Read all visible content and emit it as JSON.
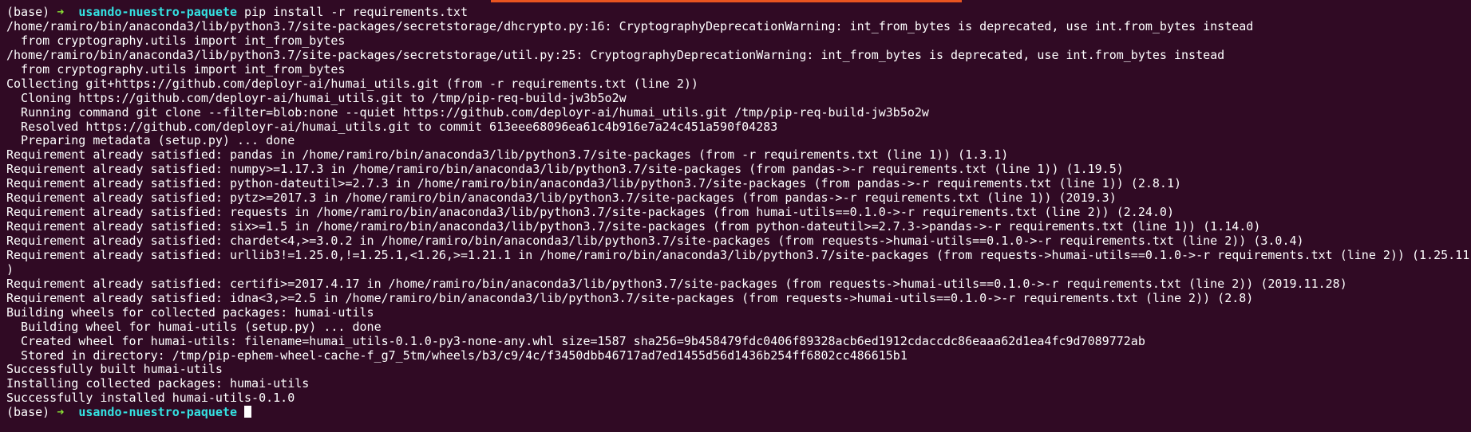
{
  "theme": {
    "background": "#300a24",
    "foreground": "#ffffff",
    "prompt_arrow_color": "#8ae234",
    "prompt_dir_color": "#34e2e2",
    "accent": "#e95420"
  },
  "prompt": {
    "env": "(base)",
    "arrow": "➜",
    "directory": "usando-nuestro-paquete",
    "command": "pip install -r requirements.txt"
  },
  "output_lines": [
    "/home/ramiro/bin/anaconda3/lib/python3.7/site-packages/secretstorage/dhcrypto.py:16: CryptographyDeprecationWarning: int_from_bytes is deprecated, use int.from_bytes instead",
    "  from cryptography.utils import int_from_bytes",
    "/home/ramiro/bin/anaconda3/lib/python3.7/site-packages/secretstorage/util.py:25: CryptographyDeprecationWarning: int_from_bytes is deprecated, use int.from_bytes instead",
    "  from cryptography.utils import int_from_bytes",
    "Collecting git+https://github.com/deployr-ai/humai_utils.git (from -r requirements.txt (line 2))",
    "  Cloning https://github.com/deployr-ai/humai_utils.git to /tmp/pip-req-build-jw3b5o2w",
    "  Running command git clone --filter=blob:none --quiet https://github.com/deployr-ai/humai_utils.git /tmp/pip-req-build-jw3b5o2w",
    "  Resolved https://github.com/deployr-ai/humai_utils.git to commit 613eee68096ea61c4b916e7a24c451a590f04283",
    "  Preparing metadata (setup.py) ... done",
    "Requirement already satisfied: pandas in /home/ramiro/bin/anaconda3/lib/python3.7/site-packages (from -r requirements.txt (line 1)) (1.3.1)",
    "Requirement already satisfied: numpy>=1.17.3 in /home/ramiro/bin/anaconda3/lib/python3.7/site-packages (from pandas->-r requirements.txt (line 1)) (1.19.5)",
    "Requirement already satisfied: python-dateutil>=2.7.3 in /home/ramiro/bin/anaconda3/lib/python3.7/site-packages (from pandas->-r requirements.txt (line 1)) (2.8.1)",
    "Requirement already satisfied: pytz>=2017.3 in /home/ramiro/bin/anaconda3/lib/python3.7/site-packages (from pandas->-r requirements.txt (line 1)) (2019.3)",
    "Requirement already satisfied: requests in /home/ramiro/bin/anaconda3/lib/python3.7/site-packages (from humai-utils==0.1.0->-r requirements.txt (line 2)) (2.24.0)",
    "Requirement already satisfied: six>=1.5 in /home/ramiro/bin/anaconda3/lib/python3.7/site-packages (from python-dateutil>=2.7.3->pandas->-r requirements.txt (line 1)) (1.14.0)",
    "Requirement already satisfied: chardet<4,>=3.0.2 in /home/ramiro/bin/anaconda3/lib/python3.7/site-packages (from requests->humai-utils==0.1.0->-r requirements.txt (line 2)) (3.0.4)",
    "Requirement already satisfied: urllib3!=1.25.0,!=1.25.1,<1.26,>=1.21.1 in /home/ramiro/bin/anaconda3/lib/python3.7/site-packages (from requests->humai-utils==0.1.0->-r requirements.txt (line 2)) (1.25.11",
    ")",
    "Requirement already satisfied: certifi>=2017.4.17 in /home/ramiro/bin/anaconda3/lib/python3.7/site-packages (from requests->humai-utils==0.1.0->-r requirements.txt (line 2)) (2019.11.28)",
    "Requirement already satisfied: idna<3,>=2.5 in /home/ramiro/bin/anaconda3/lib/python3.7/site-packages (from requests->humai-utils==0.1.0->-r requirements.txt (line 2)) (2.8)",
    "Building wheels for collected packages: humai-utils",
    "  Building wheel for humai-utils (setup.py) ... done",
    "  Created wheel for humai-utils: filename=humai_utils-0.1.0-py3-none-any.whl size=1587 sha256=9b458479fdc0406f89328acb6ed1912cdaccdc86eaaa62d1ea4fc9d7089772ab",
    "  Stored in directory: /tmp/pip-ephem-wheel-cache-f_g7_5tm/wheels/b3/c9/4c/f3450dbb46717ad7ed1455d56d1436b254ff6802cc486615b1",
    "Successfully built humai-utils",
    "Installing collected packages: humai-utils",
    "Successfully installed humai-utils-0.1.0"
  ],
  "final_prompt": {
    "env": "(base)",
    "arrow": "➜",
    "directory": "usando-nuestro-paquete"
  }
}
